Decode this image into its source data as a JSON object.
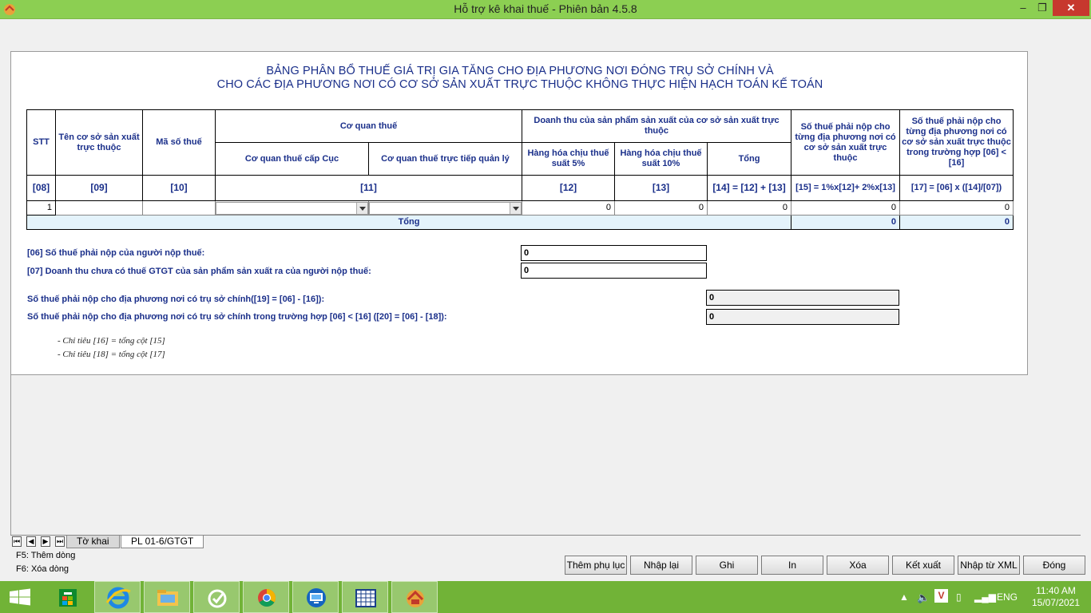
{
  "window": {
    "title": "Hỗ trợ kê khai thuế -  Phiên bản 4.5.8",
    "minimize": "–",
    "maximize": "❐",
    "close": "✕"
  },
  "heading": {
    "line1": "BẢNG PHÂN BỔ THUẾ GIÁ TRỊ GIA TĂNG CHO ĐỊA PHƯƠNG NƠI ĐÓNG TRỤ SỞ CHÍNH VÀ",
    "line2": "CHO CÁC ĐỊA PHƯƠNG NƠI CÓ CƠ SỞ SẢN XUẤT TRỰC THUỘC KHÔNG THỰC HIỆN HẠCH TOÁN KẾ TOÁN"
  },
  "table": {
    "headers": {
      "stt": "STT",
      "ten_co_so": "Tên cơ sở sản xuất trực thuộc",
      "ma_so_thue": "Mã số thuế",
      "co_quan_thue": "Cơ quan thuế",
      "cq_cap_cuc": "Cơ quan thuế cấp Cục",
      "cq_truc_tiep": "Cơ quan thuế trực tiếp quản lý",
      "doanh_thu": "Doanh thu của sản phẩm sản xuất của cơ sở sản xuất trực thuộc",
      "hh_5": "Hàng hóa chịu thuế suất 5%",
      "hh_10": "Hàng hóa chịu thuế suất 10%",
      "tong": "Tổng",
      "so_thue_phai_nop": "Số thuế phải nộp cho từng địa phương nơi có cơ sở sản xuất trực thuộc",
      "so_thue_truong_hop": "Số thuế phải nộp cho từng địa phương nơi có cơ sở sản xuất trực thuộc trong trường hợp [06] < [16]"
    },
    "codes": [
      "[08]",
      "[09]",
      "[10]",
      "[11]",
      "[12]",
      "[13]",
      "[14] = [12] + [13]",
      "[15] = 1%x[12]+ 2%x[13]",
      "[17] = [06] x ([14]/[07])"
    ],
    "row": {
      "stt": "1",
      "ten": "",
      "mst": "",
      "cq_cuc": "",
      "cq_tt": "",
      "c12": "0",
      "c13": "0",
      "c14": "0",
      "c15": "0",
      "c17": "0"
    },
    "total": {
      "label": "Tổng",
      "c15": "0",
      "c17": "0"
    }
  },
  "fields": {
    "f06_label": "[06] Số thuế phải nộp của người nộp thuế:",
    "f06_value": "0",
    "f07_label": "[07] Doanh thu chưa có thuế GTGT của sản phẩm sản xuất ra của người nộp thuế:",
    "f07_value": "0",
    "f19_label": "Số thuế phải nộp cho địa phương  nơi có trụ sở chính([19] = [06] - [16]):",
    "f19_value": "0",
    "f20_label": "Số thuế phải nộp cho địa phương nơi có trụ sở chính trong trường hợp [06] < [16]   ([20] = [06] - [18]):",
    "f20_value": "0"
  },
  "notes": [
    "- Chỉ tiêu [16] = tổng cột [15]",
    "- Chỉ tiêu [18] = tổng cột [17]"
  ],
  "sheet_tabs": [
    "Tờ khai",
    "PL 01-6/GTGT"
  ],
  "shortcuts": [
    "F5: Thêm dòng",
    "F6: Xóa dòng"
  ],
  "buttons": [
    "Thêm phụ lục",
    "Nhập lại",
    "Ghi",
    "In",
    "Xóa",
    "Kết xuất",
    "Nhập từ XML",
    "Đóng"
  ],
  "taskbar": {
    "items": [
      "start-icon",
      "store-icon",
      "internet-explorer-icon",
      "file-explorer-icon",
      "app-green-icon",
      "chrome-icon",
      "remote-desktop-icon",
      "spreadsheet-icon",
      "tax-app-icon"
    ],
    "language": "ENG",
    "time": "11:40 AM",
    "date": "15/07/2021"
  },
  "colors": {
    "titlebar": "#8ccf52",
    "taskbar": "#71b337",
    "heading": "#1a2f8a",
    "total_row": "#e4f3fb"
  }
}
